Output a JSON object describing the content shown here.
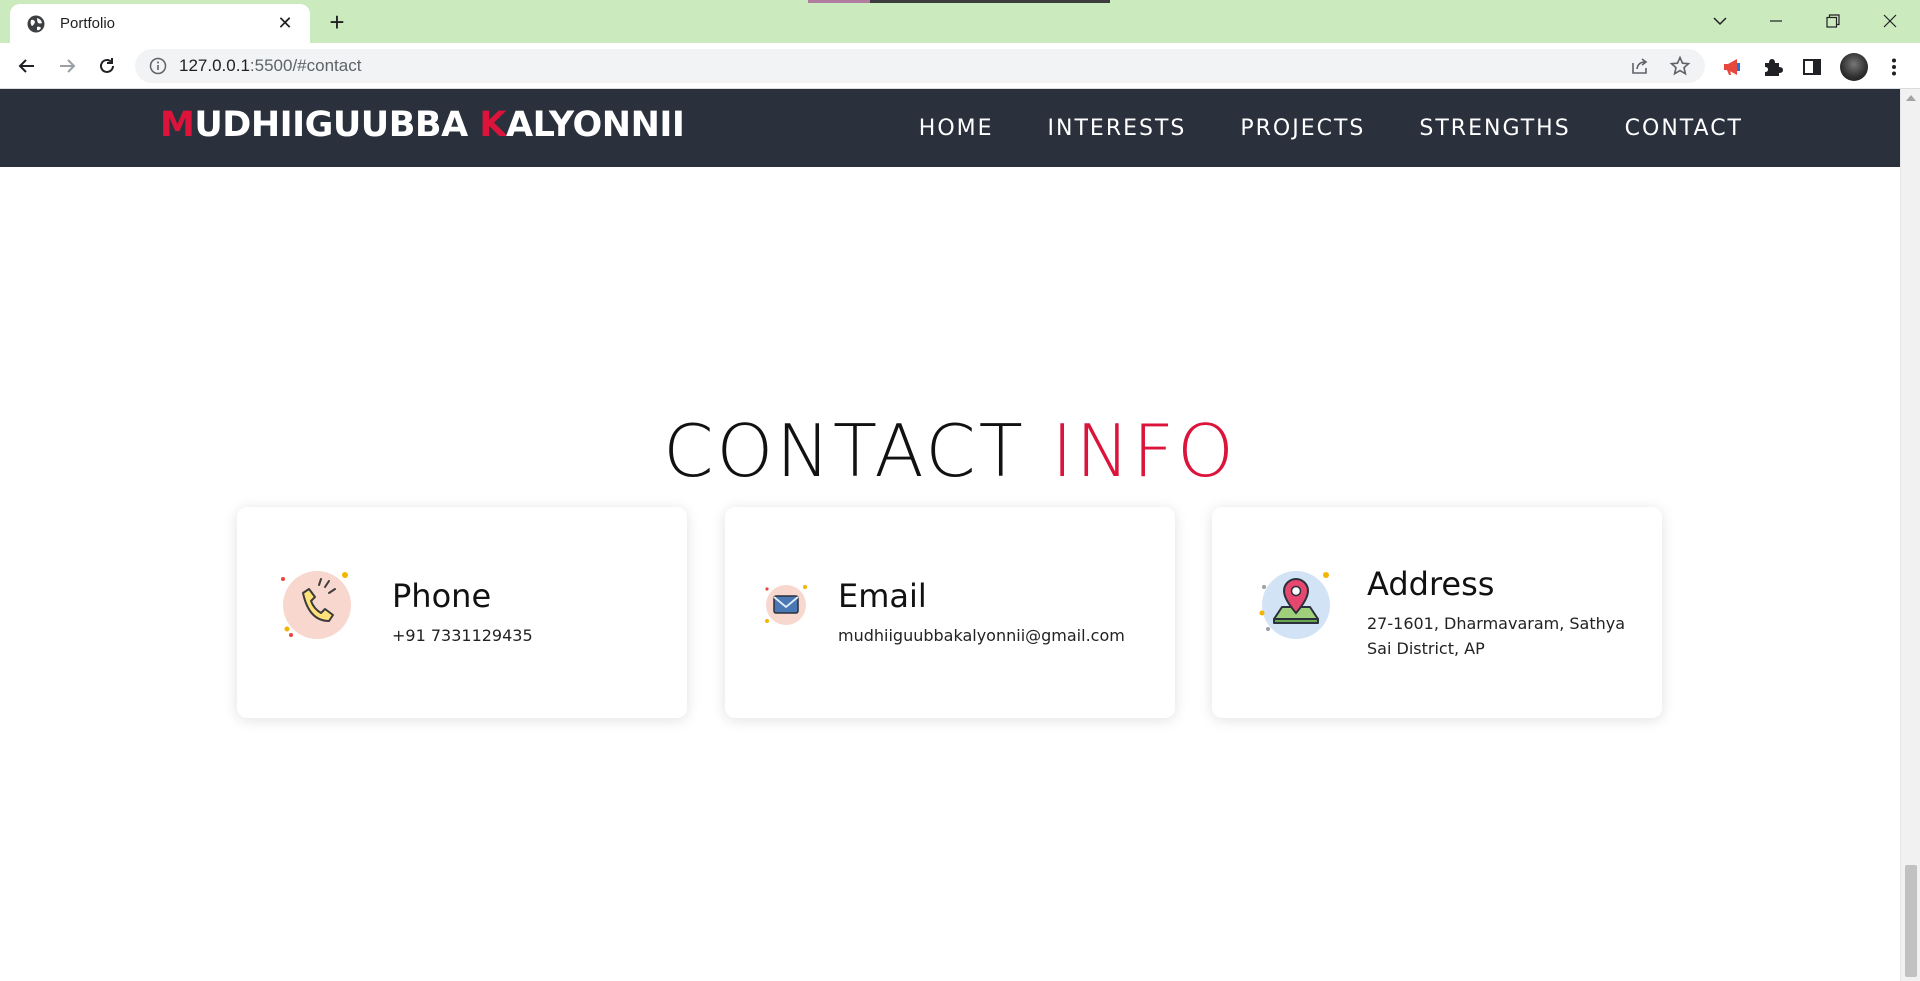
{
  "browser": {
    "tab_title": "Portfolio",
    "url_host": "127.0.0.1",
    "url_path": ":5500/#contact"
  },
  "site": {
    "logo": {
      "first_initial": "M",
      "first_rest": "UDHIIGUUBBA ",
      "last_initial": "K",
      "last_rest": "ALYONNII"
    },
    "nav": [
      "HOME",
      "INTERESTS",
      "PROJECTS",
      "STRENGTHS",
      "CONTACT"
    ]
  },
  "contact": {
    "title_main": "CONTACT",
    "title_accent": "INFO",
    "cards": [
      {
        "label": "Phone",
        "value": "+91 7331129435",
        "icon": "phone-icon"
      },
      {
        "label": "Email",
        "value": "mudhiiguubbakalyonnii@gmail.com",
        "icon": "email-icon"
      },
      {
        "label": "Address",
        "value_line1": "27-1601, Dharmavaram, Sathya",
        "value_line2": "Sai District, AP",
        "icon": "map-pin-icon"
      }
    ]
  },
  "colors": {
    "accent": "#dc143c",
    "header_bg": "#2a313d",
    "tabbar_bg": "#cbeabe"
  }
}
